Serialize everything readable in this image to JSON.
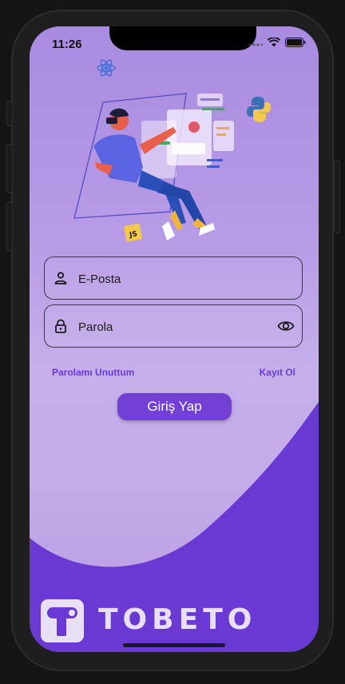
{
  "status_bar": {
    "time": "11:26"
  },
  "form": {
    "email_placeholder": "E-Posta",
    "password_placeholder": "Parola"
  },
  "links": {
    "forgot_password": "Parolamı Unuttum",
    "register": "Kayıt Ol"
  },
  "actions": {
    "login_label": "Giriş Yap"
  },
  "illustration": {
    "js_badge": "JS"
  },
  "brand": {
    "name": "TOBETO"
  },
  "colors": {
    "accent": "#7340d6",
    "wave": "#6a38d2",
    "background_top": "#a98be0",
    "link": "#6a3bd8"
  }
}
